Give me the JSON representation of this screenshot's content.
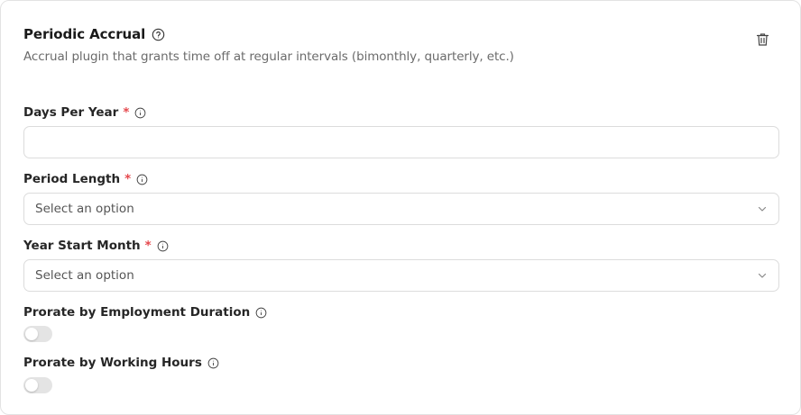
{
  "card": {
    "title": "Periodic Accrual",
    "description": "Accrual plugin that grants time off at regular intervals (bimonthly, quarterly, etc.)"
  },
  "fields": {
    "days_per_year": {
      "label": "Days Per Year",
      "required_mark": "*",
      "value": "",
      "placeholder": ""
    },
    "period_length": {
      "label": "Period Length",
      "required_mark": "*",
      "selected": "Select an option"
    },
    "year_start_month": {
      "label": "Year Start Month",
      "required_mark": "*",
      "selected": "Select an option"
    },
    "prorate_employment": {
      "label": "Prorate by Employment Duration",
      "enabled": false
    },
    "prorate_hours": {
      "label": "Prorate by Working Hours",
      "enabled": false
    }
  },
  "colors": {
    "required": "#e5484d",
    "toggle_off": "#e4e4e4"
  }
}
